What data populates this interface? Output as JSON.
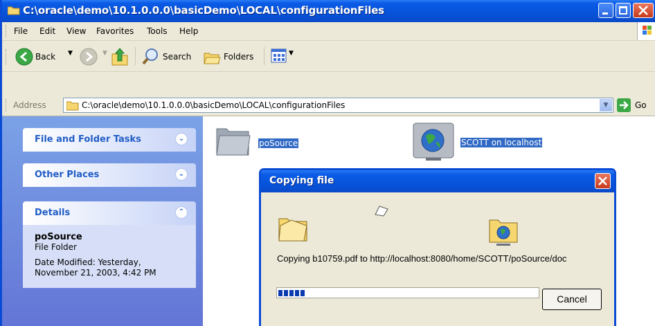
{
  "window": {
    "title": "C:\\oracle\\demo\\10.1.0.0.0\\basicDemo\\LOCAL\\configurationFiles"
  },
  "menu": [
    "File",
    "Edit",
    "View",
    "Favorites",
    "Tools",
    "Help"
  ],
  "toolbar": {
    "back": "Back",
    "search": "Search",
    "folders": "Folders"
  },
  "address": {
    "label": "Address",
    "value": "C:\\oracle\\demo\\10.1.0.0.0\\basicDemo\\LOCAL\\configurationFiles",
    "go": "Go"
  },
  "sidebar": {
    "file_tasks": "File and Folder Tasks",
    "other_places": "Other Places",
    "details": {
      "title": "Details",
      "name": "poSource",
      "type": "File Folder",
      "modified": "Date Modified: Yesterday, November 21, 2003, 4:42 PM"
    }
  },
  "items": [
    {
      "label": "poSource"
    },
    {
      "label": "SCOTT on localhost"
    }
  ],
  "dialog": {
    "title": "Copying file",
    "status": "Copying b10759.pdf to http://localhost:8080/home/SCOTT/poSource/doc",
    "progress": 0.1,
    "cancel": "Cancel"
  },
  "colors": {
    "titlebar": "#0A5BE6",
    "selection": "#316AC5",
    "sidebar": "#6D8FE0"
  }
}
